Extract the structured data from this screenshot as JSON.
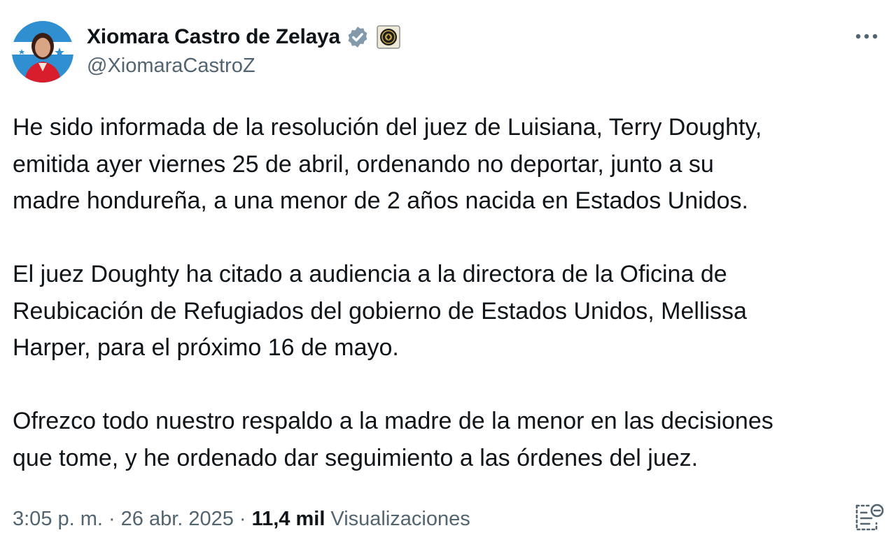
{
  "author": {
    "display_name": "Xiomara Castro de Zelaya",
    "handle": "@XiomaraCastroZ",
    "verified": true,
    "affiliate_badge": "government-seal"
  },
  "tweet": {
    "paragraphs": [
      [
        "He sido informada de la resolución del juez de Luisiana, Terry Doughty,",
        "emitida ayer viernes 25 de abril, ordenando no deportar, junto a su",
        "madre hondureña, a una menor de 2 años nacida en Estados Unidos."
      ],
      [
        "El juez Doughty ha citado a audiencia a la directora de la Oficina de",
        "Reubicación de Refugiados del gobierno de Estados Unidos, Mellissa",
        "Harper, para el próximo 16 de mayo."
      ],
      [
        "Ofrezco todo nuestro respaldo a la madre de la menor en las decisiones",
        "que tome, y he ordenado dar seguimiento a las órdenes del juez."
      ]
    ]
  },
  "meta": {
    "time": "3:05 p. m.",
    "separator": "·",
    "date": "26 abr. 2025",
    "views_count": "11,4 mil",
    "views_label": "Visualizaciones"
  },
  "icons": {
    "more": "more-icon",
    "notes": "community-notes-icon",
    "verified": "verified-badge-icon",
    "affiliate": "affiliate-badge-icon"
  },
  "colors": {
    "text": "#0f1419",
    "secondary": "#536471",
    "verified_gray": "#829aab"
  }
}
